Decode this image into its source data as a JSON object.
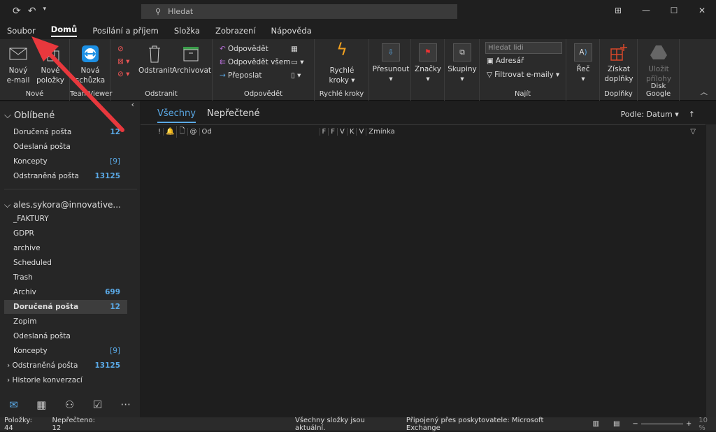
{
  "titlebar": {
    "search_placeholder": "Hledat"
  },
  "menu": [
    "Soubor",
    "Domů",
    "Posílání a příjem",
    "Složka",
    "Zobrazení",
    "Nápověda"
  ],
  "ribbon": {
    "new_email": "Nový e-mail",
    "new_items": "Nové položky",
    "group_new": "Nové",
    "new_meeting": "Nová schůzka",
    "group_teamviewer": "TeamViewer",
    "delete": "Odstranit",
    "archive": "Archivovat",
    "group_delete": "Odstranit",
    "reply": "Odpovědět",
    "reply_all": "Odpovědět všem",
    "forward": "Přeposlat",
    "group_respond": "Odpovědět",
    "quick_steps": "Rychlé kroky",
    "group_quick_steps": "Rychlé kroky",
    "move": "Přesunout",
    "tags": "Značky",
    "groups": "Skupiny",
    "search_people_placeholder": "Hledat lidi",
    "address_book": "Adresář",
    "filter_email": "Filtrovat e-maily",
    "group_find": "Najít",
    "speech": "Řeč",
    "get_addins": "Získat doplňky",
    "group_addins": "Doplňky",
    "save_attachments": "Uložit přílohy",
    "group_google_drive": "Disk Google"
  },
  "sidebar": {
    "favorites_title": "Oblíbené",
    "favorites": [
      {
        "label": "Doručená pošta",
        "count": "12"
      },
      {
        "label": "Odeslaná pošta",
        "count": ""
      },
      {
        "label": "Koncepty",
        "count": "[9]"
      },
      {
        "label": "Odstraněná pošta",
        "count": "13125"
      }
    ],
    "account": "ales.sykora@innovative...",
    "folders": [
      {
        "label": "_FAKTURY",
        "count": ""
      },
      {
        "label": "GDPR",
        "count": ""
      },
      {
        "label": "archive",
        "count": ""
      },
      {
        "label": "Scheduled",
        "count": ""
      },
      {
        "label": "Trash",
        "count": ""
      },
      {
        "label": "Archiv",
        "count": "699"
      },
      {
        "label": "Doručená pošta",
        "count": "12"
      },
      {
        "label": "Zopim",
        "count": ""
      },
      {
        "label": "Odeslaná pošta",
        "count": ""
      },
      {
        "label": "Koncepty",
        "count": "[9]"
      },
      {
        "label": "Odstraněná pošta",
        "count": "13125"
      },
      {
        "label": "Historie konverzací",
        "count": ""
      }
    ]
  },
  "main": {
    "tab_all": "Všechny",
    "tab_unread": "Nepřečtené",
    "sort": "Podle: Datum",
    "columns": [
      "!",
      "🔔",
      "🗋",
      "@",
      "Od",
      "F",
      "F",
      "V",
      "K",
      "V",
      "Zmínka"
    ]
  },
  "status": {
    "items": "Položky: 44",
    "unread": "Nepřečteno: 12",
    "folders_uptodate": "Všechny složky jsou aktuální.",
    "connected": "Připojený přes poskytovatele: Microsoft Exchange",
    "zoom": "10 %"
  },
  "colors": {
    "accent": "#5aa9e6",
    "arrow": "#e8383d"
  }
}
